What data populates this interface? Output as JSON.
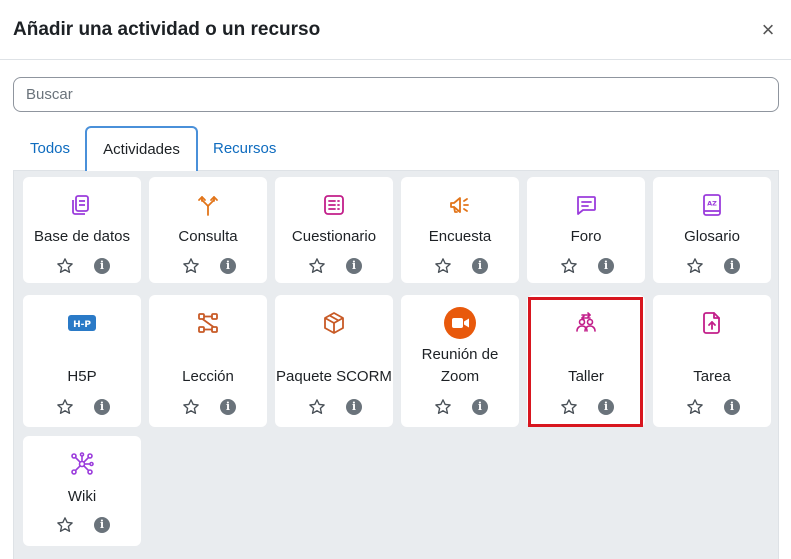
{
  "dialog": {
    "title": "Añadir una actividad o un recurso",
    "close_icon": "×"
  },
  "search": {
    "placeholder": "Buscar",
    "value": ""
  },
  "tabs": [
    {
      "label": "Todos",
      "active": false
    },
    {
      "label": "Actividades",
      "active": true
    },
    {
      "label": "Recursos",
      "active": false
    }
  ],
  "items": [
    {
      "label": "Base de datos",
      "icon": "database-icon",
      "color": "#9b3cdc"
    },
    {
      "label": "Consulta",
      "icon": "choice-icon",
      "color": "#e2751a"
    },
    {
      "label": "Cuestionario",
      "icon": "quiz-icon",
      "color": "#c21f8a"
    },
    {
      "label": "Encuesta",
      "icon": "feedback-icon",
      "color": "#e2751a"
    },
    {
      "label": "Foro",
      "icon": "forum-icon",
      "color": "#9b3cdc"
    },
    {
      "label": "Glosario",
      "icon": "glossary-icon",
      "color": "#9b3cdc"
    },
    {
      "label": "H5P",
      "icon": "h5p-icon",
      "color": "#2a7ac7"
    },
    {
      "label": "Lección",
      "icon": "lesson-icon",
      "color": "#c85a26"
    },
    {
      "label": "Paquete SCORM",
      "icon": "scorm-icon",
      "color": "#c85a26"
    },
    {
      "label": "Reunión de Zoom",
      "label_line1": "Reunión de",
      "label_line2": "Zoom",
      "icon": "zoom-icon",
      "color": "#e8590c"
    },
    {
      "label": "Taller",
      "icon": "workshop-icon",
      "color": "#c21f8a"
    },
    {
      "label": "Tarea",
      "icon": "assignment-icon",
      "color": "#c21f8a"
    },
    {
      "label": "Wiki",
      "icon": "wiki-icon",
      "color": "#9b3cdc"
    }
  ],
  "highlighted_item": "Taller"
}
